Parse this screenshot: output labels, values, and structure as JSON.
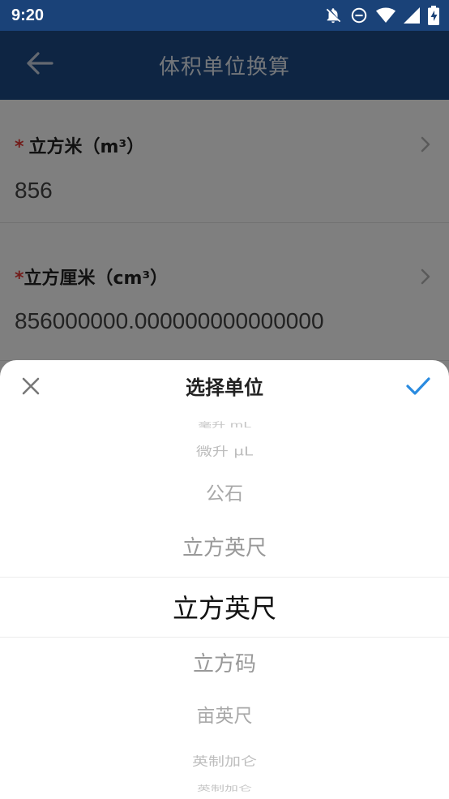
{
  "status_bar": {
    "time": "9:20",
    "icons": [
      "notifications-off-icon",
      "do-not-disturb-icon",
      "wifi-icon",
      "signal-icon",
      "battery-charging-icon"
    ]
  },
  "app_bar": {
    "back_icon": "arrow-left-icon",
    "title": "体积单位换算"
  },
  "fields": [
    {
      "required_mark": "*",
      "label": "立方米（m³）",
      "value": "856"
    },
    {
      "required_mark": "*",
      "label": "立方厘米（cm³）",
      "value": "856000000.000000000000000"
    }
  ],
  "sheet": {
    "title": "选择单位",
    "close_icon": "close-icon",
    "confirm_icon": "check-icon",
    "picker": {
      "items_above": [
        "毫升 mL",
        "微升 μL",
        "公石",
        "立方英尺"
      ],
      "selected": "立方英尺",
      "items_below": [
        "立方码",
        "亩英尺",
        "英制加仑",
        "英制加仑"
      ]
    }
  },
  "colors": {
    "status_bar": "#1a4278",
    "app_bar": "#1c4a86",
    "accent": "#2a8be0",
    "required": "#e53935"
  }
}
